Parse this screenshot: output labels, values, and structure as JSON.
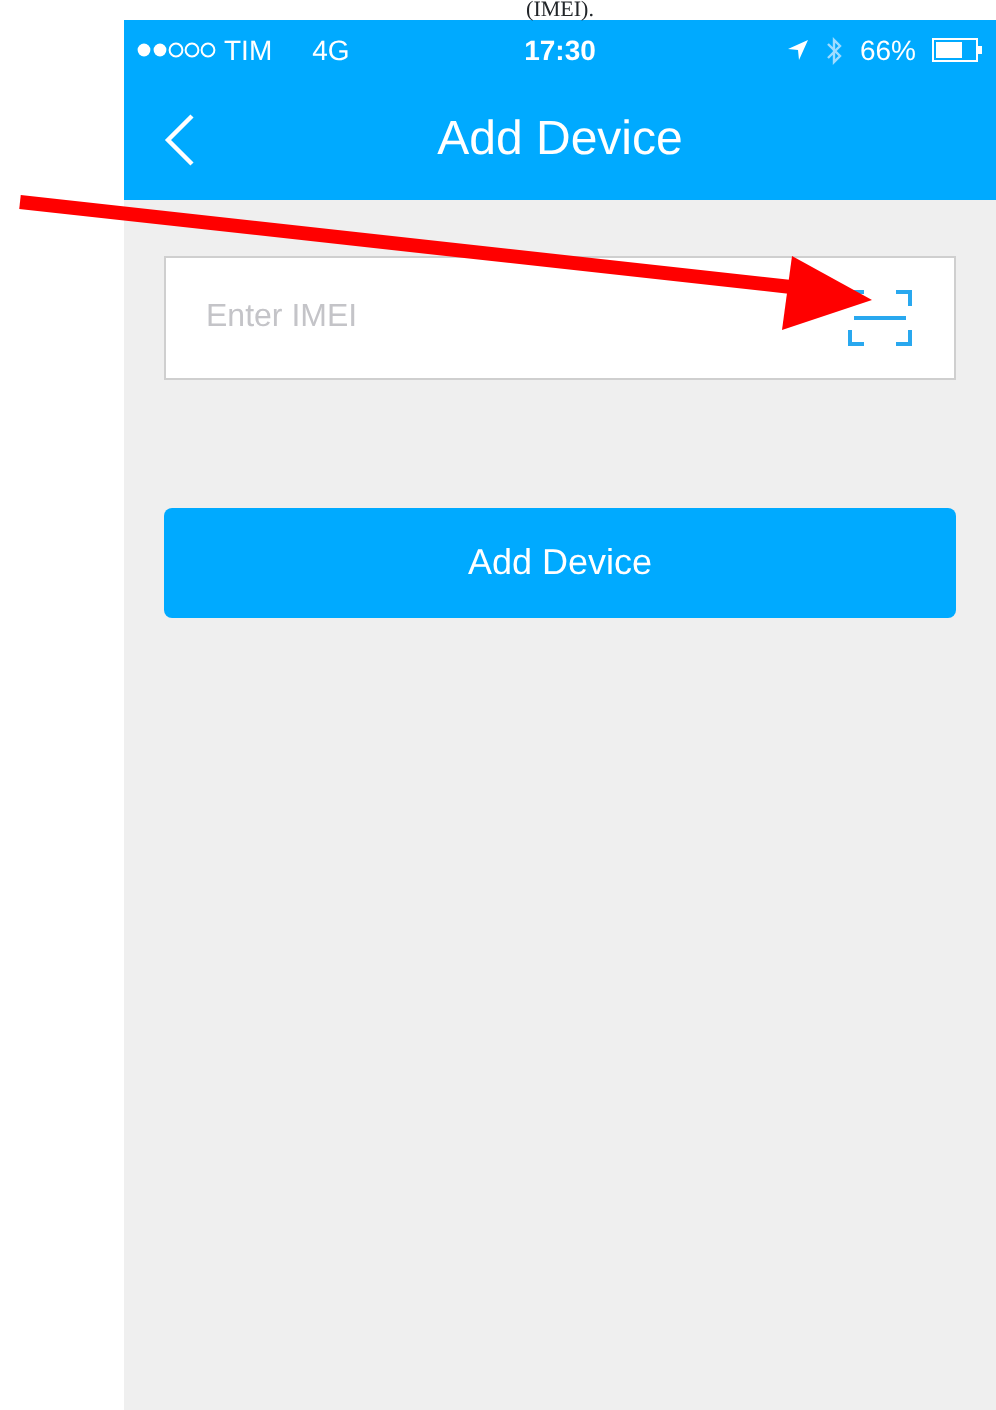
{
  "caption": "(IMEI).",
  "status_bar": {
    "carrier": "TIM",
    "network": "4G",
    "time": "17:30",
    "battery": "66%"
  },
  "nav_bar": {
    "title": "Add Device"
  },
  "imei_field": {
    "placeholder": "Enter IMEI"
  },
  "button": {
    "label": "Add Device"
  }
}
